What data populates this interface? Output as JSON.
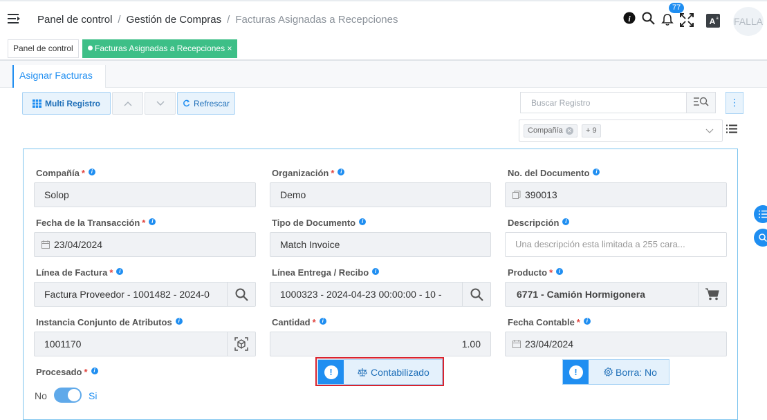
{
  "header": {
    "breadcrumb": [
      "Panel de control",
      "Gestión de Compras",
      "Facturas Asignadas a Recepciones"
    ],
    "separator": "/",
    "notification_count": "77",
    "user_label": "FALLA"
  },
  "tabs": [
    {
      "label": "Panel de control"
    },
    {
      "label": "Facturas Asignadas a Recepciones",
      "close": "×"
    }
  ],
  "subtab": {
    "label": "Asignar Facturas"
  },
  "toolbar": {
    "multi_label": "Multi Registro",
    "refresh_label": "Refrescar",
    "search_placeholder": "Buscar Registro",
    "kebab": "⋮",
    "filter_chip": "Compañía",
    "filter_more": "+ 9"
  },
  "form": {
    "company": {
      "label": "Compañía",
      "value": "Solop"
    },
    "organization": {
      "label": "Organización",
      "value": "Demo"
    },
    "doc_no": {
      "label": "No. del Documento",
      "value": "390013"
    },
    "trx_date": {
      "label": "Fecha de la Transacción",
      "value": "23/04/2024"
    },
    "doc_type": {
      "label": "Tipo de Documento",
      "value": "Match Invoice"
    },
    "description": {
      "label": "Descripción",
      "placeholder": "Una descripción esta limitada a 255 cara..."
    },
    "invoice_line": {
      "label": "Línea de Factura",
      "value": "Factura Proveedor - 1001482 - 2024-0"
    },
    "receipt_line": {
      "label": "Línea Entrega / Recibo",
      "value": "1000323 - 2024-04-23 00:00:00 - 10 -"
    },
    "product": {
      "label": "Producto",
      "value": "6771 - Camión Hormigonera"
    },
    "attribute_set": {
      "label": "Instancia Conjunto de Atributos",
      "value": "1001170"
    },
    "quantity": {
      "label": "Cantidad",
      "value": "1.00"
    },
    "acct_date": {
      "label": "Fecha Contable",
      "value": "23/04/2024"
    },
    "processed": {
      "label": "Procesado",
      "off_label": "No",
      "on_label": "Si",
      "value": true
    }
  },
  "status": {
    "posted_label": "Contabilizado",
    "delete_label": "Borra: No"
  },
  "colors": {
    "accent": "#1f8ef1",
    "tab_active": "#3dbf87",
    "required": "#e0443e",
    "highlight": "#d9232e"
  }
}
